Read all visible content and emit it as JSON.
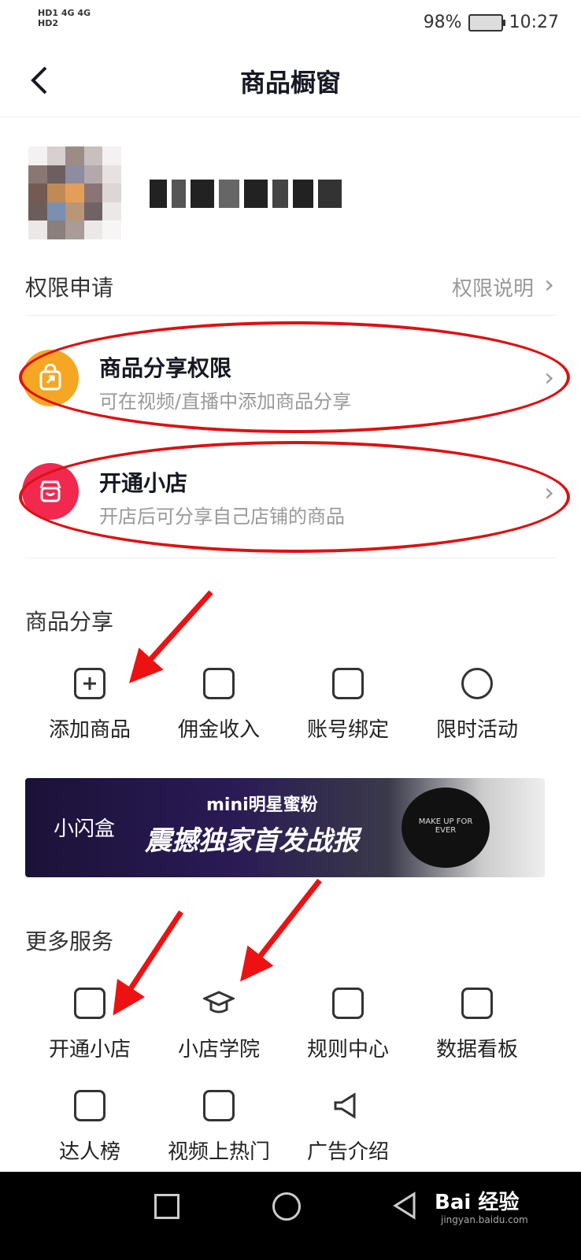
{
  "status_bar": {
    "left_top": "HD1 4G 4G",
    "left_bottom": "HD2",
    "battery": "98%",
    "time": "10:27"
  },
  "header": {
    "title": "商品橱窗"
  },
  "permissions": {
    "label": "权限申请",
    "explain": "权限说明",
    "items": [
      {
        "title": "商品分享权限",
        "subtitle": "可在视频/直播中添加商品分享",
        "icon": "share-bag-icon",
        "color": "#f5a623"
      },
      {
        "title": "开通小店",
        "subtitle": "开店后可分享自己店铺的商品",
        "icon": "shop-icon",
        "color": "#f2284f"
      }
    ]
  },
  "share": {
    "label": "商品分享",
    "items": [
      {
        "label": "添加商品",
        "icon": "add-product-icon"
      },
      {
        "label": "佣金收入",
        "icon": "wallet-icon"
      },
      {
        "label": "账号绑定",
        "icon": "link-icon"
      },
      {
        "label": "限时活动",
        "icon": "clock-icon"
      }
    ]
  },
  "banner": {
    "brand": "小闪盒",
    "headline": "mini明星蜜粉",
    "main": "震撼独家首发战报",
    "product": "MAKE UP FOR EVER"
  },
  "more": {
    "label": "更多服务",
    "items": [
      {
        "label": "开通小店",
        "icon": "shop-icon"
      },
      {
        "label": "小店学院",
        "icon": "graduation-cap-icon"
      },
      {
        "label": "规则中心",
        "icon": "document-icon"
      },
      {
        "label": "数据看板",
        "icon": "chart-icon"
      },
      {
        "label": "达人榜",
        "icon": "badge-icon"
      },
      {
        "label": "视频上热门",
        "icon": "video-icon"
      },
      {
        "label": "广告介绍",
        "icon": "megaphone-icon"
      }
    ]
  },
  "watermark": {
    "text": "Bai 经验",
    "sub": "jingyan.baidu.com"
  },
  "colors": {
    "annotation_red": "#dd1111",
    "accent_orange": "#f5a623",
    "accent_red": "#f2284f"
  }
}
